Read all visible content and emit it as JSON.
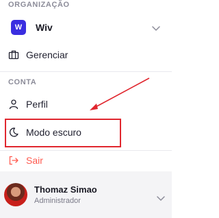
{
  "org_section": {
    "label": "ORGANIZAÇÃO"
  },
  "org_selector": {
    "badge": "W",
    "name": "Wiv"
  },
  "menu_top": [
    {
      "label": "Gerenciar",
      "icon": "briefcase-icon"
    }
  ],
  "account_section": {
    "label": "CONTA"
  },
  "menu_account": [
    {
      "label": "Perfil",
      "icon": "user-icon"
    },
    {
      "label": "Modo escuro",
      "icon": "moon-icon"
    },
    {
      "label": "Sair",
      "icon": "logout-icon"
    }
  ],
  "user": {
    "name": "Thomaz Simao",
    "role": "Administrador"
  },
  "colors": {
    "accent": "#3a2ee0",
    "logout": "#ff5a4f",
    "annotation": "#e0262e"
  }
}
